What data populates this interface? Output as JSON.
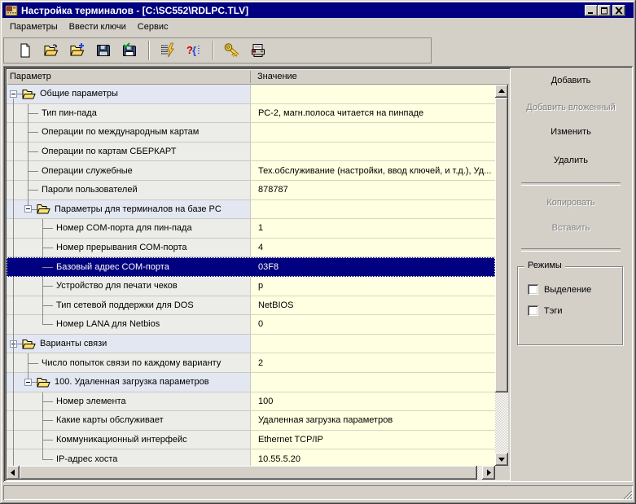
{
  "window": {
    "title": "Настройка терминалов - [C:\\SC552\\RDLPC.TLV]",
    "icon": "terminal-app-icon",
    "controls": [
      "minimize",
      "maximize",
      "close"
    ]
  },
  "menu": {
    "items": [
      "Параметры",
      "Ввести ключи",
      "Сервис"
    ]
  },
  "toolbar": {
    "groups": [
      [
        "new-document",
        "open-file",
        "add-file",
        "save-file",
        "save-all"
      ],
      [
        "verify-parameters",
        "syntax-check"
      ],
      [
        "enter-keys",
        "print-terminal"
      ]
    ]
  },
  "grid": {
    "columns": {
      "param": "Параметр",
      "value": "Значение"
    },
    "rows": [
      {
        "label": "Общие параметры",
        "value": "",
        "level": 0,
        "type": "folder"
      },
      {
        "label": "Тип пин-пада",
        "value": "РС-2, магн.полоса читается на пинпаде",
        "level": 1,
        "type": "item"
      },
      {
        "label": "Операции по международным картам",
        "value": "",
        "level": 1,
        "type": "item"
      },
      {
        "label": "Операции по картам СБЕРКАРТ",
        "value": "",
        "level": 1,
        "type": "item"
      },
      {
        "label": "Операции служебные",
        "value": "Тех.обслуживание (настройки, ввод ключей, и т.д.), Уд...",
        "level": 1,
        "type": "item"
      },
      {
        "label": "Пароли пользователей",
        "value": "878787",
        "level": 1,
        "type": "item"
      },
      {
        "label": "Параметры для терминалов на базе PC",
        "value": "",
        "level": 1,
        "type": "folder"
      },
      {
        "label": "Номер COM-порта для пин-пада",
        "value": "1",
        "level": 2,
        "type": "item"
      },
      {
        "label": "Номер прерывания COM-порта",
        "value": "4",
        "level": 2,
        "type": "item"
      },
      {
        "label": "Базовый адрес COM-порта",
        "value": "03F8",
        "level": 2,
        "type": "item",
        "selected": true
      },
      {
        "label": "Устройство для печати чеков",
        "value": "p",
        "level": 2,
        "type": "item"
      },
      {
        "label": "Тип сетевой поддержки для DOS",
        "value": "NetBIOS",
        "level": 2,
        "type": "item"
      },
      {
        "label": "Номер LANA для Netbios",
        "value": "0",
        "level": 2,
        "type": "item"
      },
      {
        "label": "Варианты связи",
        "value": "",
        "level": 0,
        "type": "folder"
      },
      {
        "label": "Число попыток связи по каждому варианту",
        "value": "2",
        "level": 1,
        "type": "item"
      },
      {
        "label": "100. Удаленная загрузка параметров",
        "value": "",
        "level": 1,
        "type": "folder"
      },
      {
        "label": "Номер элемента",
        "value": "100",
        "level": 2,
        "type": "item"
      },
      {
        "label": "Какие карты обслуживает",
        "value": "Удаленная загрузка параметров",
        "level": 2,
        "type": "item"
      },
      {
        "label": "Коммуникационный интерфейс",
        "value": "Ethernet TCP/IP",
        "level": 2,
        "type": "item"
      },
      {
        "label": "IP-адрес хоста",
        "value": "10.55.5.20",
        "level": 2,
        "type": "item"
      }
    ]
  },
  "sidebar": {
    "buttons": [
      {
        "label": "Добавить",
        "enabled": true
      },
      {
        "label": "Добавить вложенный",
        "enabled": false
      },
      {
        "label": "Изменить",
        "enabled": true
      },
      {
        "label": "Удалить",
        "enabled": true
      },
      {
        "label": "Копировать",
        "enabled": false
      },
      {
        "label": "Вставить",
        "enabled": false
      }
    ],
    "modes_group": {
      "title": "Режимы",
      "checkboxes": [
        {
          "label": "Выделение",
          "checked": false
        },
        {
          "label": "Тэги",
          "checked": false
        }
      ]
    }
  },
  "statusbar": {
    "text": ""
  },
  "colors": {
    "titlebar": "#000080",
    "selection": "#000080",
    "value_cell": "#FFFFE1",
    "folder_row": "#E3E7F1",
    "item_row": "#ECECE9"
  }
}
